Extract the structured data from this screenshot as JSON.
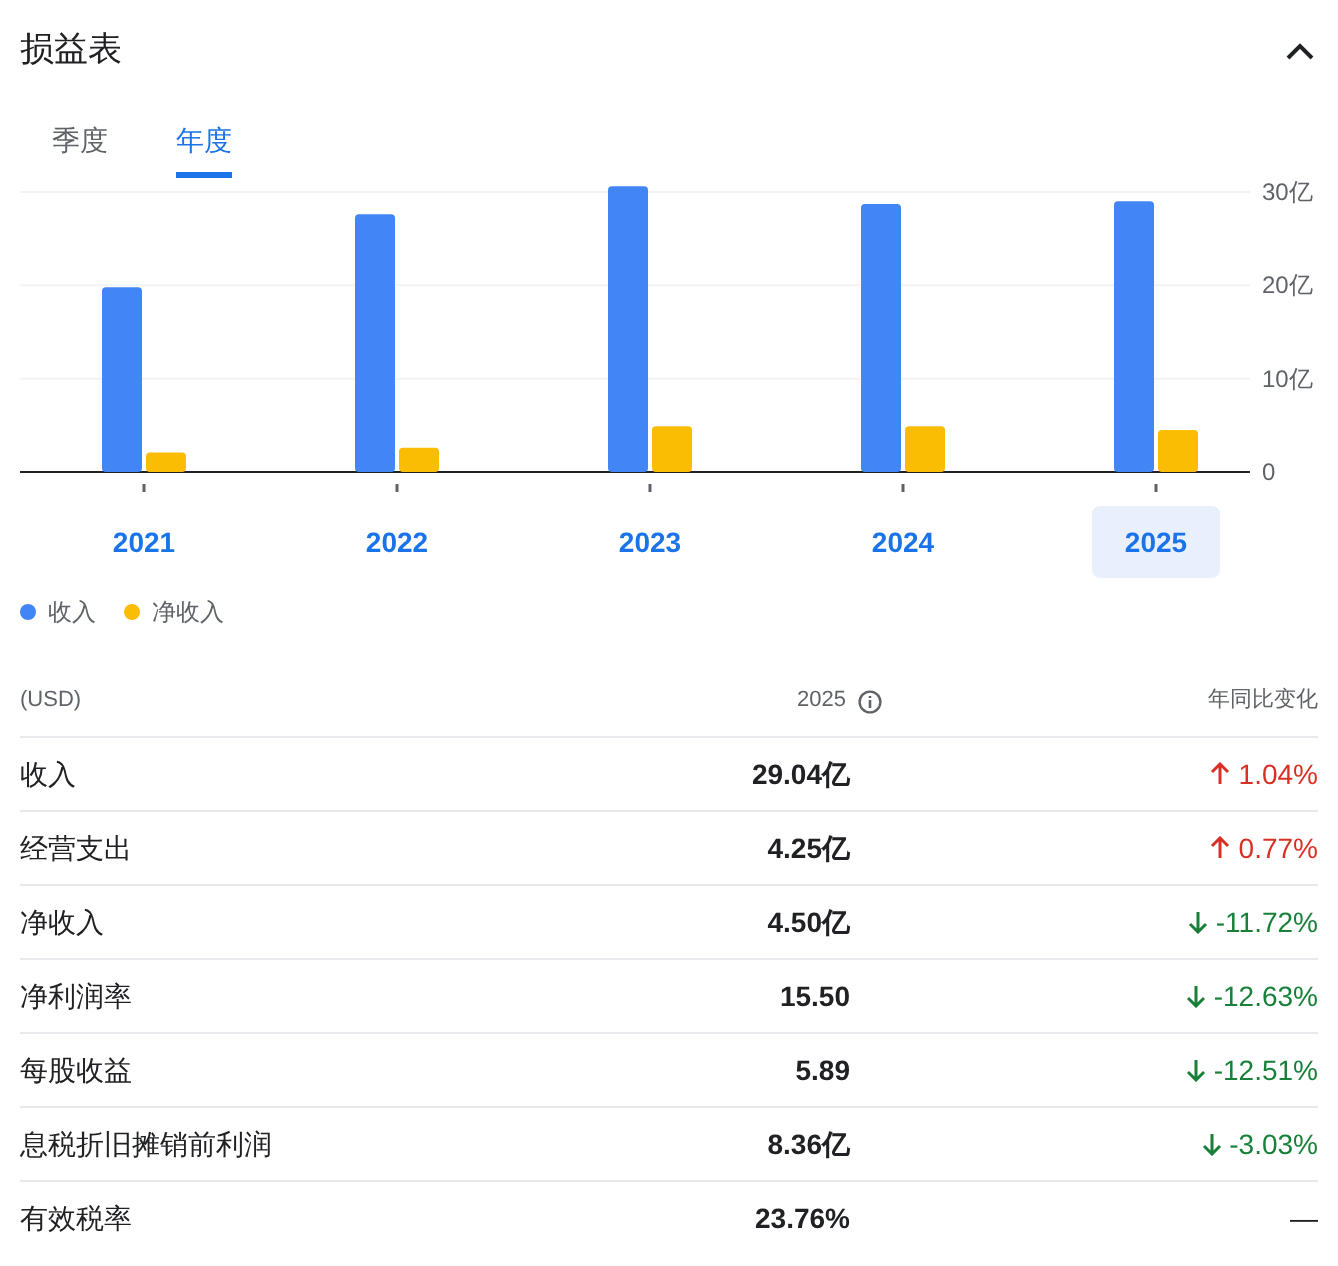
{
  "title": "损益表",
  "tabs": [
    {
      "label": "季度",
      "selected": false
    },
    {
      "label": "年度",
      "selected": true
    }
  ],
  "chart": {
    "chart_data": {
      "type": "bar",
      "categories": [
        "2021",
        "2022",
        "2023",
        "2024",
        "2025"
      ],
      "series": [
        {
          "name": "收入",
          "color": "#4285f4",
          "values": [
            19.8,
            27.6,
            30.6,
            28.7,
            29.0
          ]
        },
        {
          "name": "净收入",
          "color": "#fbbc04",
          "values": [
            2.1,
            2.6,
            4.9,
            4.9,
            4.5
          ]
        }
      ],
      "ylim": [
        0,
        31
      ],
      "grid": true,
      "yticks": [
        {
          "value": 0,
          "label": "0"
        },
        {
          "value": 10,
          "label": "10亿"
        },
        {
          "value": 20,
          "label": "20亿"
        },
        {
          "value": 30,
          "label": "30亿"
        }
      ]
    },
    "year_buttons": [
      {
        "selected": false
      },
      {
        "selected": false
      },
      {
        "selected": false
      },
      {
        "selected": false
      },
      {
        "selected": true
      }
    ]
  },
  "table": {
    "columns": [
      "(USD)",
      "2025",
      "年同比变化"
    ],
    "rows": [
      {
        "label": "收入",
        "value": "29.04亿",
        "change": "1.04%",
        "kind": "up"
      },
      {
        "label": "经营支出",
        "value": "4.25亿",
        "change": "0.77%",
        "kind": "up"
      },
      {
        "label": "净收入",
        "value": "4.50亿",
        "change": "-11.72%",
        "kind": "down"
      },
      {
        "label": "净利润率",
        "value": "15.50",
        "change": "-12.63%",
        "kind": "down"
      },
      {
        "label": "每股收益",
        "value": "5.89",
        "change": "-12.51%",
        "kind": "down"
      },
      {
        "label": "息税折旧摊销前利润",
        "value": "8.36亿",
        "change": "-3.03%",
        "kind": "down"
      },
      {
        "label": "有效税率",
        "value": "23.76%",
        "change": "—",
        "kind": "none"
      }
    ]
  }
}
